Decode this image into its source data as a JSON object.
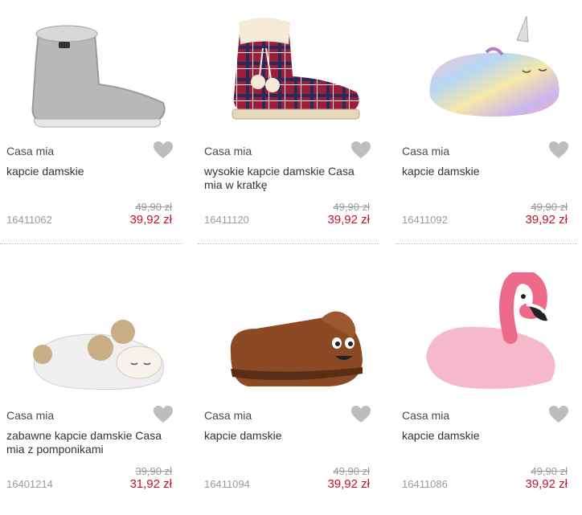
{
  "products": [
    {
      "brand": "Casa mia",
      "name": "kapcie damskie",
      "sku": "16411062",
      "old_price": "49,90 zł",
      "price": "39,92 zł",
      "image": "grey-knit-bootie"
    },
    {
      "brand": "Casa mia",
      "name": "wysokie kapcie damskie Casa mia w kratkę",
      "sku": "16411120",
      "old_price": "49,90 zł",
      "price": "39,92 zł",
      "image": "red-plaid-bootie"
    },
    {
      "brand": "Casa mia",
      "name": "kapcie damskie",
      "sku": "16411092",
      "old_price": "49,90 zł",
      "price": "39,92 zł",
      "image": "rainbow-unicorn-slipper"
    },
    {
      "brand": "Casa mia",
      "name": "zabawne kapcie damskie Casa mia z pomponikami",
      "sku": "16401214",
      "old_price": "39,90 zł",
      "price": "31,92 zł",
      "image": "sheep-pompom-slipper"
    },
    {
      "brand": "Casa mia",
      "name": "kapcie damskie",
      "sku": "16411094",
      "old_price": "49,90 zł",
      "price": "39,92 zł",
      "image": "brown-emoji-slipper"
    },
    {
      "brand": "Casa mia",
      "name": "kapcie damskie",
      "sku": "16411086",
      "old_price": "49,90 zł",
      "price": "39,92 zł",
      "image": "pink-flamingo-slipper"
    }
  ],
  "colors": {
    "sale": "#c8102e",
    "muted": "#9a9a9a",
    "heart": "#bdbdbd"
  }
}
